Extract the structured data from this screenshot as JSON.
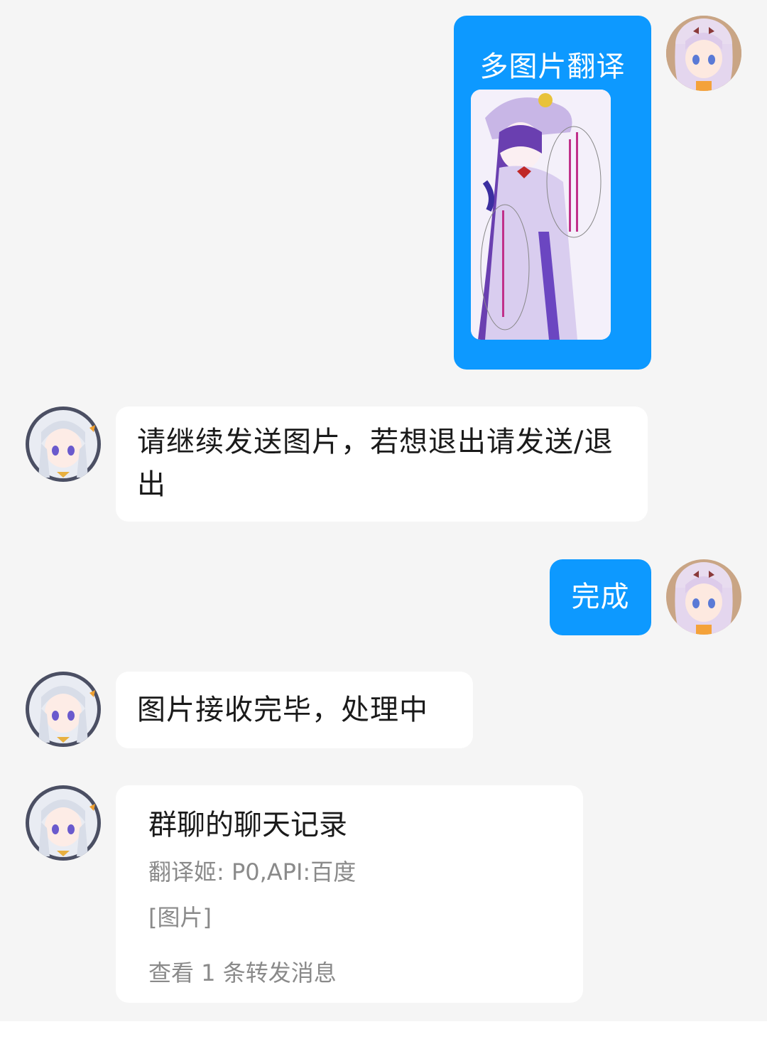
{
  "messages": [
    {
      "sender": "self",
      "text": "多图片翻译",
      "attachment": "image"
    },
    {
      "sender": "bot",
      "text": "请继续发送图片，若想退出请发送/退出"
    },
    {
      "sender": "self",
      "text": "完成"
    },
    {
      "sender": "bot",
      "text": "图片接收完毕，处理中"
    },
    {
      "sender": "bot",
      "type": "forwarded",
      "title": "群聊的聊天记录",
      "lines": [
        "翻译姬: P0,API:百度",
        "[图片]"
      ],
      "footer": "查看 1 条转发消息"
    }
  ],
  "colors": {
    "self_bubble": "#0d99ff",
    "bot_bubble": "#ffffff",
    "background": "#f5f5f5"
  },
  "icons": {
    "self_avatar": "anime-girl-avatar-icon",
    "bot_avatar": "anime-girl-silver-hair-avatar-icon"
  }
}
